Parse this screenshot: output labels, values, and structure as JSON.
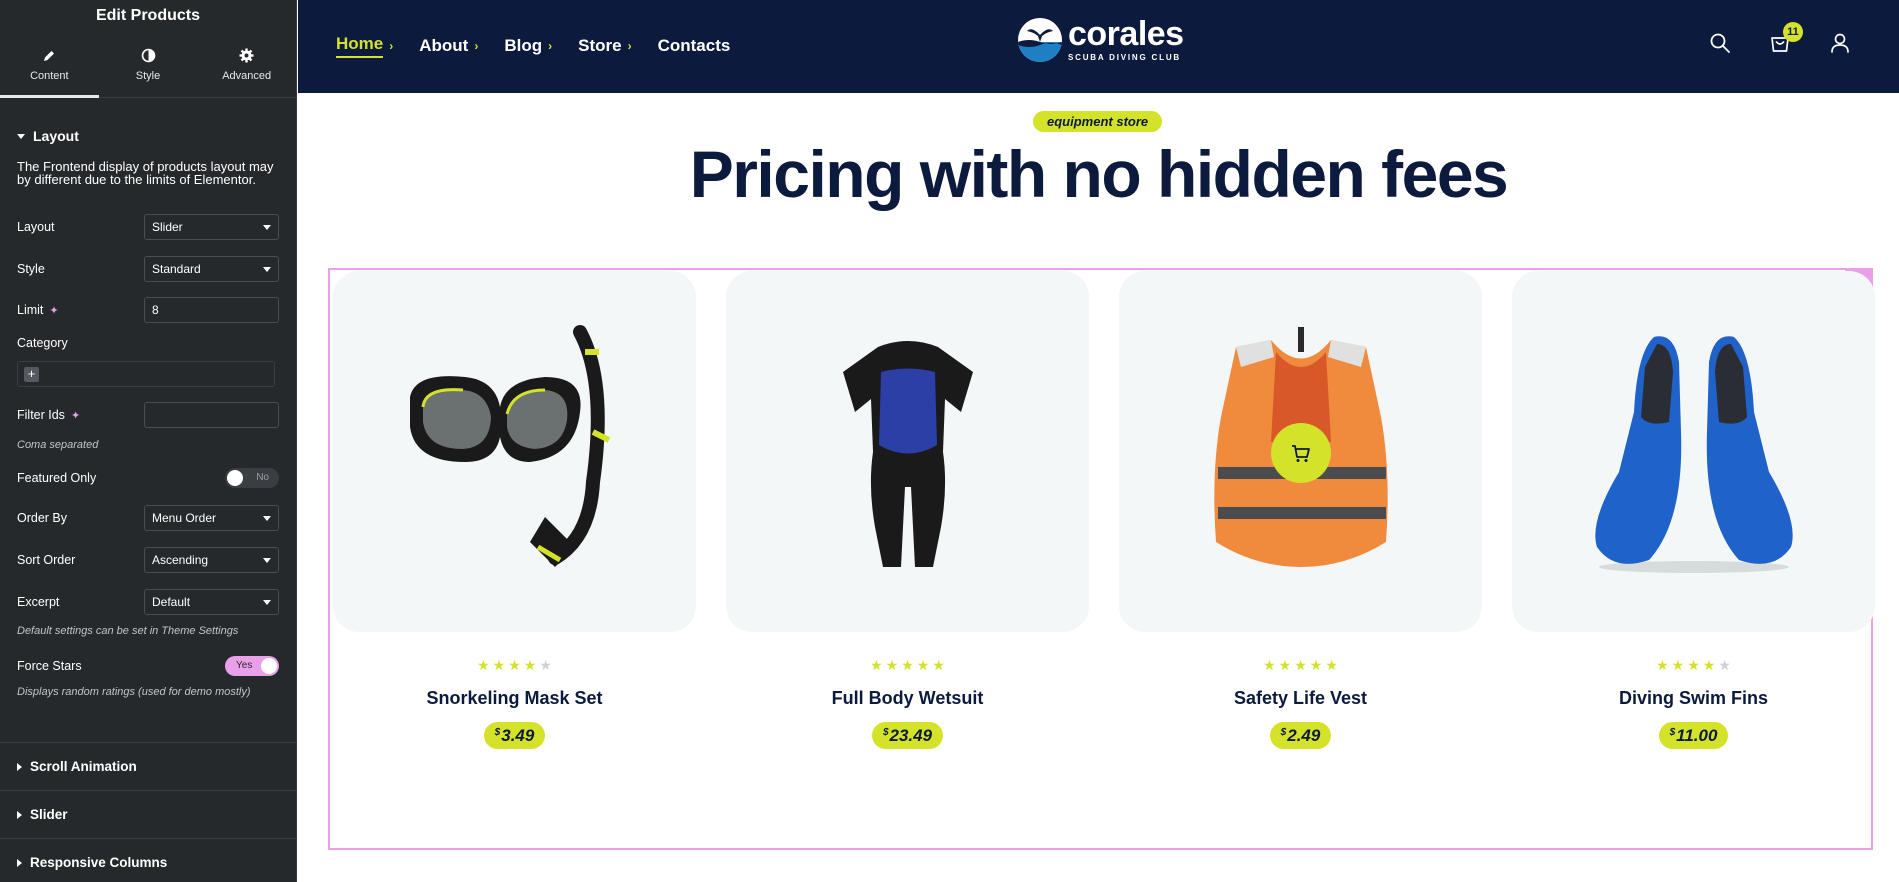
{
  "panel": {
    "title": "Edit Products",
    "tabs": [
      {
        "label": "Content",
        "icon": "pencil-icon",
        "active": true
      },
      {
        "label": "Style",
        "icon": "half-circle-icon",
        "active": false
      },
      {
        "label": "Advanced",
        "icon": "gear-icon",
        "active": false
      }
    ],
    "layout_section": "Layout",
    "note": "The Frontend display of products layout may by different due to the limits of Elementor.",
    "fields": {
      "layout": {
        "label": "Layout",
        "value": "Slider"
      },
      "style": {
        "label": "Style",
        "value": "Standard"
      },
      "limit": {
        "label": "Limit",
        "value": "8"
      },
      "category": {
        "label": "Category",
        "add": "+"
      },
      "filter_ids": {
        "label": "Filter Ids",
        "value": "",
        "hint": "Coma separated"
      },
      "featured_only": {
        "label": "Featured Only",
        "value": "No"
      },
      "order_by": {
        "label": "Order By",
        "value": "Menu Order"
      },
      "sort_order": {
        "label": "Sort Order",
        "value": "Ascending"
      },
      "excerpt": {
        "label": "Excerpt",
        "value": "Default",
        "hint": "Default settings can be set in Theme Settings"
      },
      "force_stars": {
        "label": "Force Stars",
        "value": "Yes",
        "hint": "Displays random ratings (used for demo mostly)"
      }
    },
    "collapsed_sections": [
      "Scroll Animation",
      "Slider",
      "Responsive Columns"
    ]
  },
  "header": {
    "nav": [
      {
        "label": "Home",
        "active": true,
        "has_chevron": true
      },
      {
        "label": "About",
        "active": false,
        "has_chevron": true
      },
      {
        "label": "Blog",
        "active": false,
        "has_chevron": true
      },
      {
        "label": "Store",
        "active": false,
        "has_chevron": true
      },
      {
        "label": "Contacts",
        "active": false,
        "has_chevron": false
      }
    ],
    "logo": {
      "name": "corales",
      "tagline": "SCUBA DIVING CLUB"
    },
    "cart_count": "11",
    "icons": [
      "search-icon",
      "cart-icon",
      "user-icon"
    ]
  },
  "main": {
    "tag": "equipment store",
    "title": "Pricing with no hidden fees",
    "products": [
      {
        "name": "Snorkeling Mask Set",
        "currency": "$",
        "price": "3.49",
        "rating": 4
      },
      {
        "name": "Full Body Wetsuit",
        "currency": "$",
        "price": "23.49",
        "rating": 5
      },
      {
        "name": "Safety Life Vest",
        "currency": "$",
        "price": "2.49",
        "rating": 5
      },
      {
        "name": "Diving Swim Fins",
        "currency": "$",
        "price": "11.00",
        "rating": 4
      }
    ]
  },
  "colors": {
    "navy": "#0c1a3d",
    "accent": "#d4e22a",
    "editor_pink": "#e9a0e8",
    "panel_bg": "#26292c"
  }
}
